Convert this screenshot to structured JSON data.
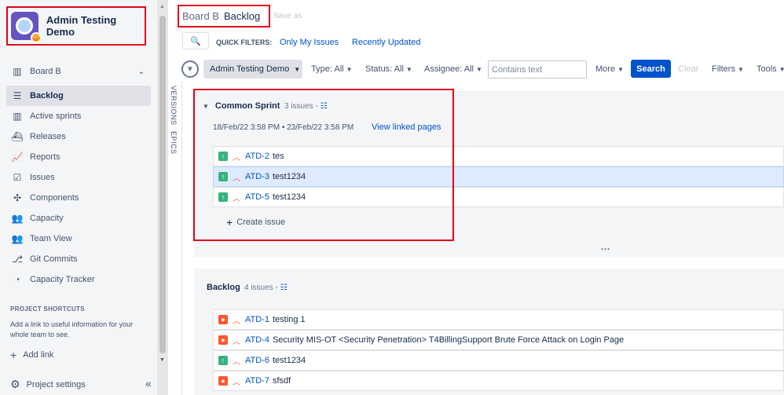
{
  "sidebar": {
    "project_name": "Admin Testing Demo",
    "board_label": "Board B",
    "items": [
      {
        "label": "Backlog",
        "icon": "backlog-icon",
        "active": true
      },
      {
        "label": "Active sprints",
        "icon": "board-icon"
      },
      {
        "label": "Releases",
        "icon": "ship-icon"
      },
      {
        "label": "Reports",
        "icon": "chart-icon"
      },
      {
        "label": "Issues",
        "icon": "issues-icon"
      },
      {
        "label": "Components",
        "icon": "puzzle-icon"
      },
      {
        "label": "Capacity",
        "icon": "people-icon"
      },
      {
        "label": "Team View",
        "icon": "team-icon"
      },
      {
        "label": "Git Commits",
        "icon": "git-icon"
      },
      {
        "label": "Capacity Tracker",
        "icon": "gauge-icon"
      }
    ],
    "shortcuts_title": "PROJECT SHORTCUTS",
    "shortcuts_text": "Add a link to useful information for your whole team to see.",
    "add_link": "Add link",
    "project_settings": "Project settings"
  },
  "header": {
    "breadcrumb_board": "Board B",
    "breadcrumb_page": "Backlog",
    "save_as": "Save as",
    "quick_filters_label": "QUICK FILTERS:",
    "quick_filters": [
      "Only My Issues",
      "Recently Updated"
    ]
  },
  "filters": {
    "project": "Admin Testing Demo",
    "type": "Type: All",
    "status": "Status: All",
    "assignee": "Assignee: All",
    "text_placeholder": "Contains text",
    "more": "More",
    "search": "Search",
    "clear": "Clear",
    "filters": "Filters",
    "tools": "Tools"
  },
  "vertical_tabs": [
    "VERSIONS",
    "EPICS"
  ],
  "sprint": {
    "name": "Common Sprint",
    "count": "3 issues -",
    "dates": "18/Feb/22 3:58 PM • 23/Feb/22 3:58 PM",
    "view_linked": "View linked pages",
    "issues": [
      {
        "type": "story",
        "key": "ATD-2",
        "summary": "tes"
      },
      {
        "type": "story",
        "key": "ATD-3",
        "summary": "test1234"
      },
      {
        "type": "story",
        "key": "ATD-5",
        "summary": "test1234"
      }
    ],
    "create_issue": "Create issue",
    "more_dots": "..."
  },
  "backlog": {
    "name": "Backlog",
    "count": "4 issues -",
    "issues": [
      {
        "type": "bug",
        "key": "ATD-1",
        "summary": "testing 1"
      },
      {
        "type": "bug",
        "key": "ATD-4",
        "summary": "Security MIS-OT <Security Penetration> T4BillingSupport Brute Force Attack on Login Page"
      },
      {
        "type": "story",
        "key": "ATD-6",
        "summary": "test1234"
      },
      {
        "type": "bug",
        "key": "ATD-7",
        "summary": "sfsdf"
      }
    ]
  },
  "colors": {
    "accent": "#0052cc",
    "highlight": "#e3001b",
    "story": "#36b37e",
    "bug": "#ff5630"
  }
}
